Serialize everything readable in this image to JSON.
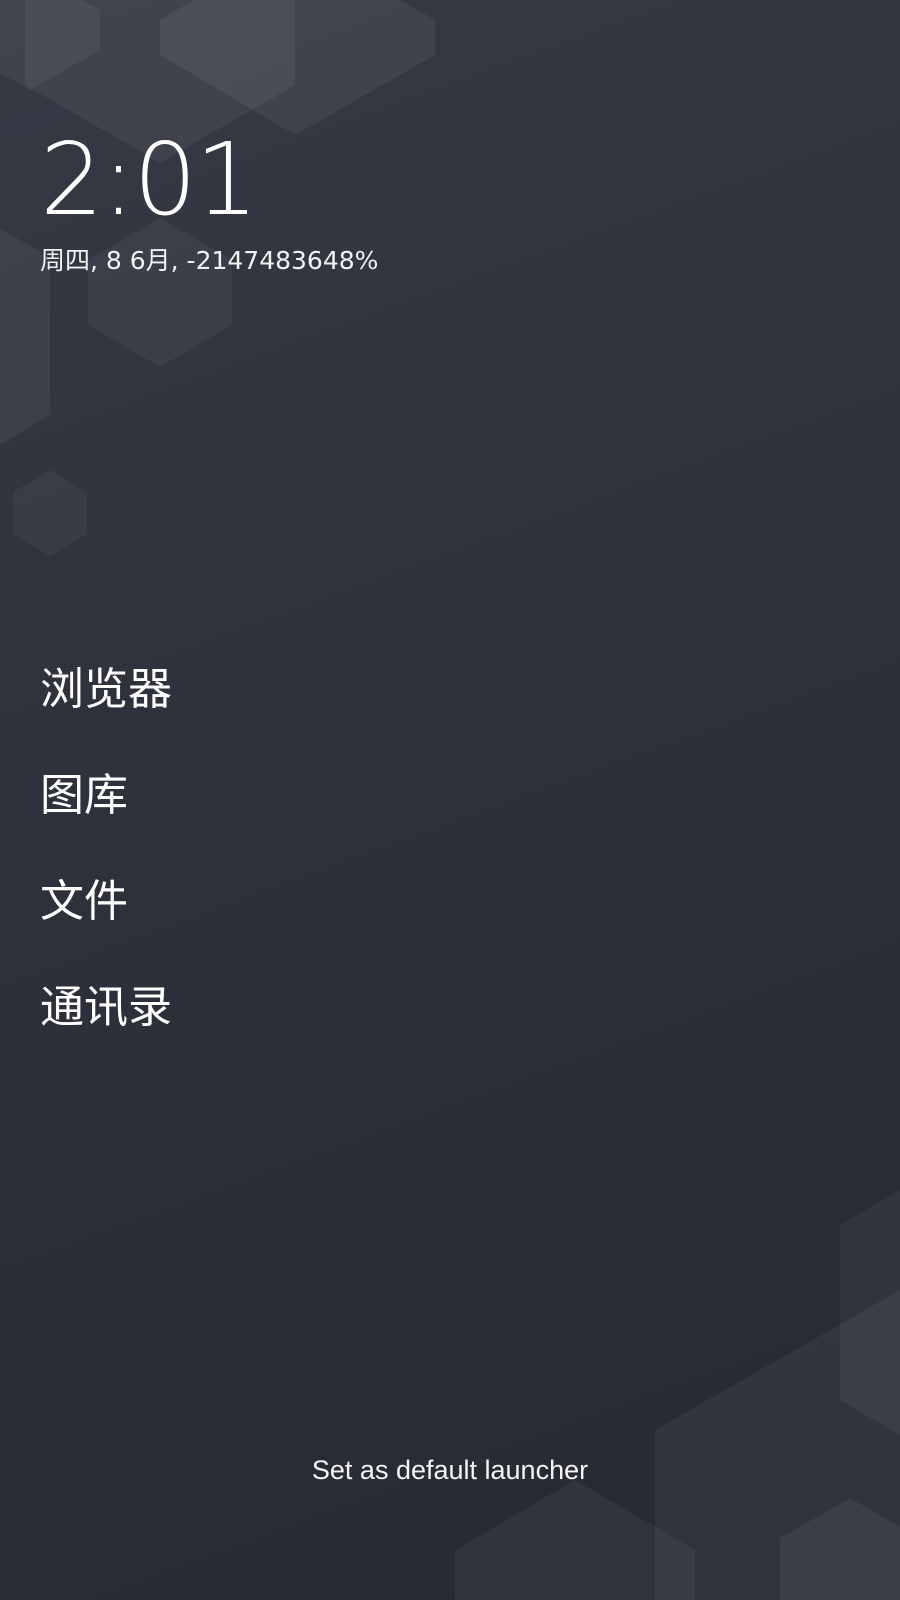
{
  "clock": {
    "time": "2:01",
    "date": "周四, 8 6月, -2147483648%"
  },
  "apps": [
    {
      "label": "浏览器"
    },
    {
      "label": "图库"
    },
    {
      "label": "文件"
    },
    {
      "label": "通讯录"
    }
  ],
  "footer": {
    "default_launcher_label": "Set as default launcher"
  },
  "colors": {
    "background": "#2e313b",
    "text": "#ffffff"
  }
}
